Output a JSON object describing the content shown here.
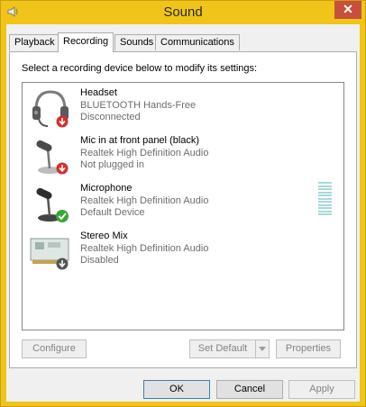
{
  "window": {
    "title": "Sound",
    "close_glyph": "✕"
  },
  "tabs": [
    {
      "label": "Playback",
      "active": false
    },
    {
      "label": "Recording",
      "active": true
    },
    {
      "label": "Sounds",
      "active": false
    },
    {
      "label": "Communications",
      "active": false
    }
  ],
  "panel": {
    "instruction": "Select a recording device below to modify its settings:"
  },
  "devices": [
    {
      "name": "Headset",
      "driver": "BLUETOOTH Hands-Free",
      "status": "Disconnected",
      "icon": "headset-icon",
      "badge": "disconnected-badge-icon"
    },
    {
      "name": "Mic in at front panel (black)",
      "driver": "Realtek High Definition Audio",
      "status": "Not plugged in",
      "icon": "microphone-icon",
      "badge": "unplugged-badge-icon"
    },
    {
      "name": "Microphone",
      "driver": "Realtek High Definition Audio",
      "status": "Default Device",
      "icon": "microphone-icon",
      "badge": "default-check-icon"
    },
    {
      "name": "Stereo Mix",
      "driver": "Realtek High Definition Audio",
      "status": "Disabled",
      "icon": "sound-card-icon",
      "badge": "disabled-badge-icon"
    }
  ],
  "buttons": {
    "configure": "Configure",
    "set_default": "Set Default",
    "properties": "Properties",
    "ok": "OK",
    "cancel": "Cancel",
    "apply": "Apply"
  },
  "colors": {
    "title_bar": "#f0c419",
    "close_button": "#c7503d",
    "default_check": "#35a835",
    "badge_red": "#d6302b"
  }
}
